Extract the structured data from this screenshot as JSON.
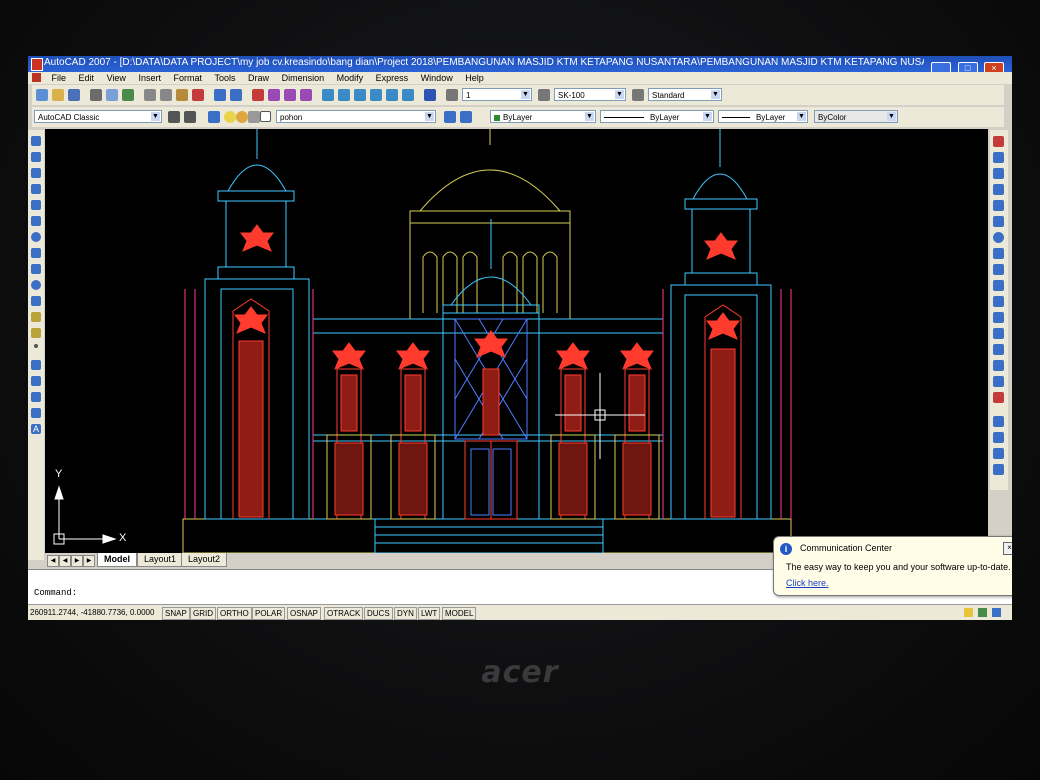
{
  "window": {
    "title": "AutoCAD 2007 - [D:\\DATA\\DATA PROJECT\\my job cv.kreasindo\\bang dian\\Project 2018\\PEMBANGUNAN MASJID KTM KETAPANG NUSANTARA\\PEMBANGUNAN MASJID KTM KETAPANG NUSA",
    "buttons": [
      "_",
      "□",
      "×"
    ]
  },
  "menu": {
    "items": [
      "File",
      "Edit",
      "View",
      "Insert",
      "Format",
      "Tools",
      "Draw",
      "Dimension",
      "Modify",
      "Express",
      "Window",
      "Help"
    ]
  },
  "toolbar": {
    "workspace": "AutoCAD Classic",
    "layer": "pohon",
    "dimstyle_value": "1",
    "textstyle_value": "SK-100",
    "tablestyle_value": "Standard",
    "color": "ByLayer",
    "linetype": "ByLayer",
    "lineweight": "ByLayer",
    "plotstyle": "ByColor"
  },
  "ucs": {
    "y_label": "Y",
    "x_label": "X"
  },
  "tabs": {
    "items": [
      "Model",
      "Layout1",
      "Layout2"
    ],
    "active": "Model"
  },
  "command": {
    "prompt": "Command:"
  },
  "status": {
    "coords": "260911.2744, -41880.7736, 0.0000",
    "buttons": [
      "SNAP",
      "GRID",
      "ORTHO",
      "POLAR",
      "OSNAP",
      "OTRACK",
      "DUCS",
      "DYN",
      "LWT",
      "MODEL"
    ]
  },
  "notification": {
    "title": "Communication Center",
    "body": "The easy way to keep you and your software up-to-date.",
    "link": "Click here."
  },
  "laptop": {
    "brand": "acer"
  },
  "colors": {
    "cad_bg": "#000000",
    "cyan": "#3ec8ff",
    "red": "#ff3b2e",
    "magenta": "#ff3d8f",
    "yellow": "#d8cf58",
    "blue": "#4e7dff"
  }
}
